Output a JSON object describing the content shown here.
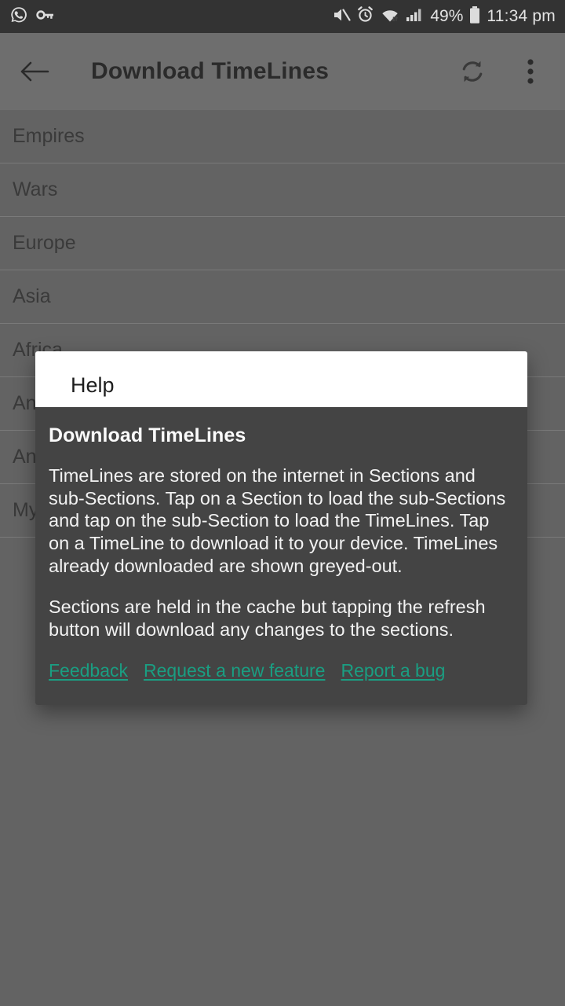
{
  "statusbar": {
    "left_icons": [
      {
        "name": "whatsapp-icon"
      },
      {
        "name": "vpn-key-icon"
      }
    ],
    "right_icons": [
      {
        "name": "volume-mute-icon"
      },
      {
        "name": "alarm-clock-icon"
      },
      {
        "name": "wifi-transfer-icon"
      },
      {
        "name": "cellular-signal-icon"
      }
    ],
    "battery_percent": "49%",
    "battery_icon": "battery-icon",
    "time": "11:34 pm"
  },
  "appbar": {
    "back_icon": "arrow-back-icon",
    "title": "Download TimeLines",
    "refresh_icon": "refresh-icon",
    "overflow_icon": "more-vert-icon"
  },
  "list": {
    "items": [
      {
        "label": "Empires"
      },
      {
        "label": "Wars"
      },
      {
        "label": "Europe"
      },
      {
        "label": "Asia"
      },
      {
        "label": "Africa"
      },
      {
        "label": "An"
      },
      {
        "label": "An"
      },
      {
        "label": "My"
      }
    ]
  },
  "dialog": {
    "title": "Help",
    "heading": "Download TimeLines",
    "paragraphs": [
      "TimeLines are stored on the internet in Sections and sub-Sections. Tap on a Section to load the sub-Sections and tap on the sub-Section to load the TimeLines. Tap on a TimeLine to download it to your device. TimeLines already downloaded are shown greyed-out.",
      "Sections are held in the cache but tapping the refresh button will download any changes to the sections."
    ],
    "links": [
      {
        "label": "Feedback"
      },
      {
        "label": "Request a new feature"
      },
      {
        "label": "Report a bug"
      }
    ]
  },
  "colors": {
    "statusbar_bg": "#333333",
    "appbar_bg": "#6e6e6e",
    "scrim_bg": "#636363",
    "dialog_body_bg": "#444444",
    "dialog_header_bg": "#ffffff",
    "link_teal": "#1a9e82"
  }
}
